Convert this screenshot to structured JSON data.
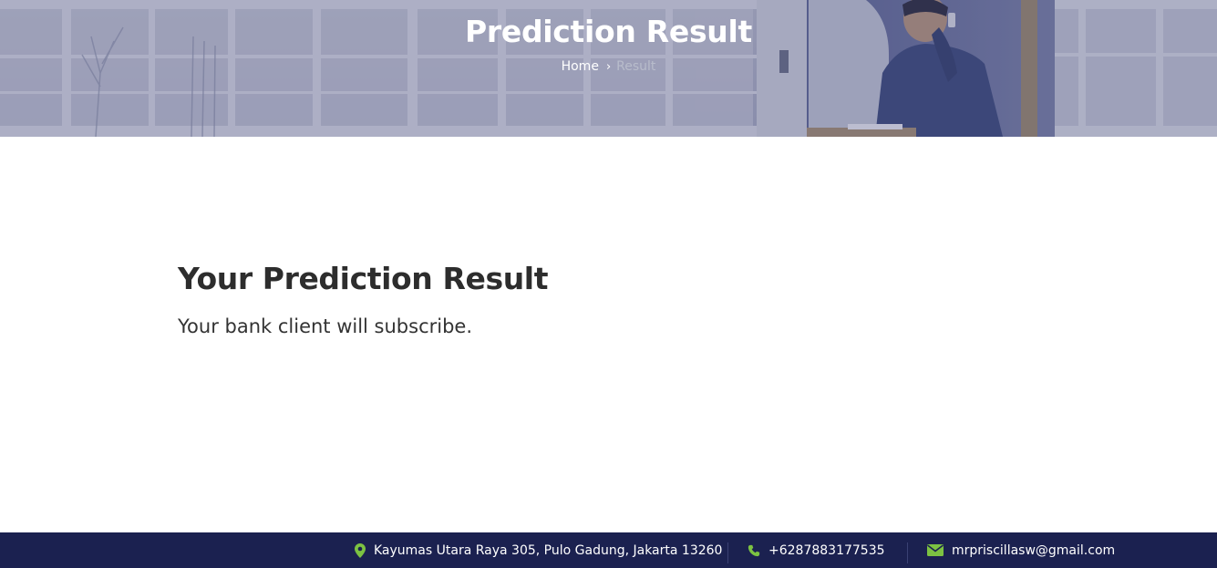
{
  "hero": {
    "title": "Prediction Result",
    "breadcrumb": {
      "home": "Home",
      "separator": "›",
      "current": "Result"
    }
  },
  "main": {
    "heading": "Your Prediction Result",
    "result_text": "Your bank client will subscribe."
  },
  "footer": {
    "address": "Kayumas Utara Raya 305, Pulo Gadung, Jakarta 13260",
    "phone": "+6287883177535",
    "email": "mrpriscillasw@gmail.com",
    "icons": {
      "address": "map-pin-icon",
      "phone": "phone-icon",
      "email": "envelope-icon"
    }
  },
  "colors": {
    "footer_bg": "#1b2150",
    "accent_green": "#7cc242",
    "heading_text": "#2d2d2d"
  }
}
